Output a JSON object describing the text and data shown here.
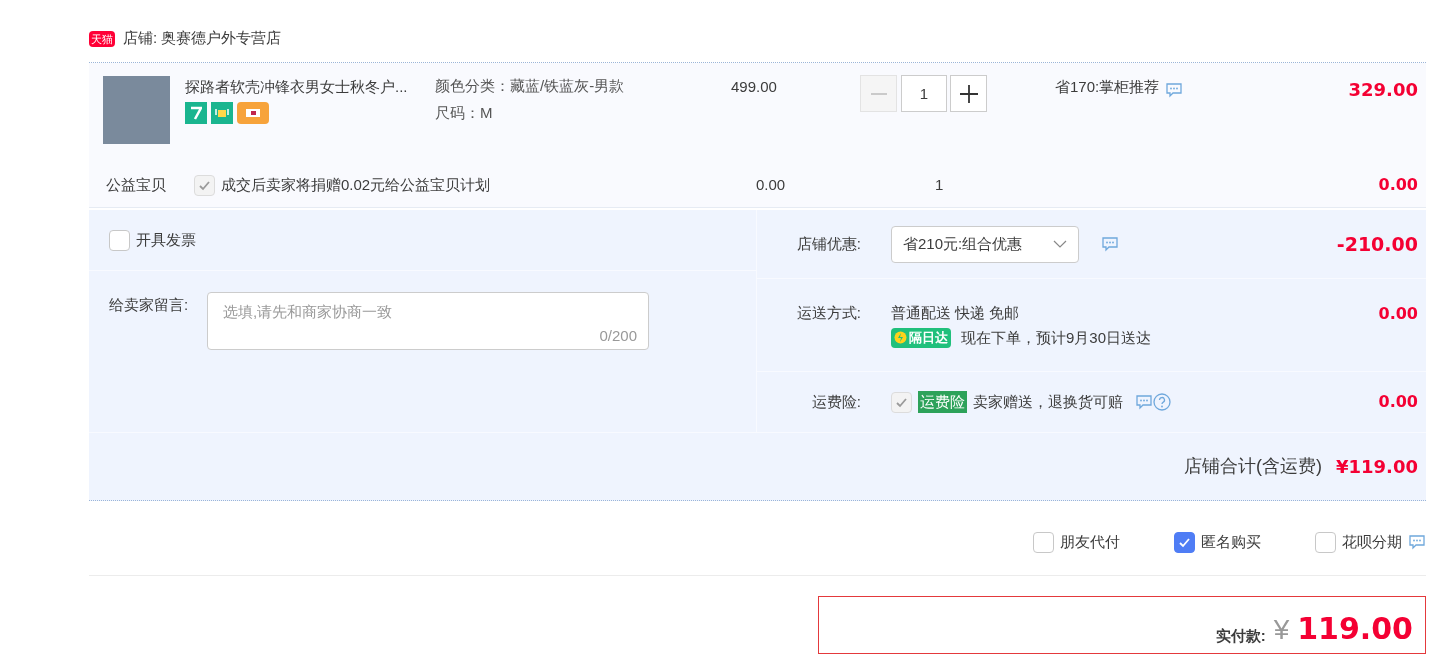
{
  "shop": {
    "badge": "天猫",
    "label": "店铺: 奥赛德户外专营店"
  },
  "item": {
    "title": "探路者软壳冲锋衣男女士秋冬户...",
    "sku": [
      "颜色分类：藏蓝/铁蓝灰-男款",
      "尺码：M"
    ],
    "unit_price": "499.00",
    "quantity": "1",
    "discount": "省170:掌柜推荐",
    "subtotal": "329.00"
  },
  "charity": {
    "label": "公益宝贝",
    "checked": true,
    "text": "成交后卖家将捐赠0.02元给公益宝贝计划",
    "price": "0.00",
    "quantity": "1",
    "subtotal": "0.00"
  },
  "invoice": {
    "label": "开具发票",
    "checked": false
  },
  "message": {
    "label": "给卖家留言:",
    "placeholder": "选填,请先和商家协商一致",
    "counter": "0/200"
  },
  "shop_discount": {
    "label": "店铺优惠:",
    "value": "省210元:组合优惠",
    "amount": "-210.00"
  },
  "shipping": {
    "label": "运送方式:",
    "method": "普通配送 快递 免邮",
    "badge": "隔日达",
    "eta": "现在下单，预计9月30日送达",
    "amount": "0.00"
  },
  "insurance": {
    "label": "运费险:",
    "checked": true,
    "badge": "运费险",
    "text": "卖家赠送，退换货可赔",
    "amount": "0.00"
  },
  "total": {
    "label": "店铺合计(含运费)",
    "amount": "¥119.00"
  },
  "options": [
    {
      "label": "朋友代付",
      "checked": false,
      "note": false
    },
    {
      "label": "匿名购买",
      "checked": true,
      "note": false
    },
    {
      "label": "花呗分期",
      "checked": false,
      "note": true
    }
  ],
  "payment": {
    "label": "实付款:",
    "currency": "¥",
    "amount": "119.00"
  }
}
